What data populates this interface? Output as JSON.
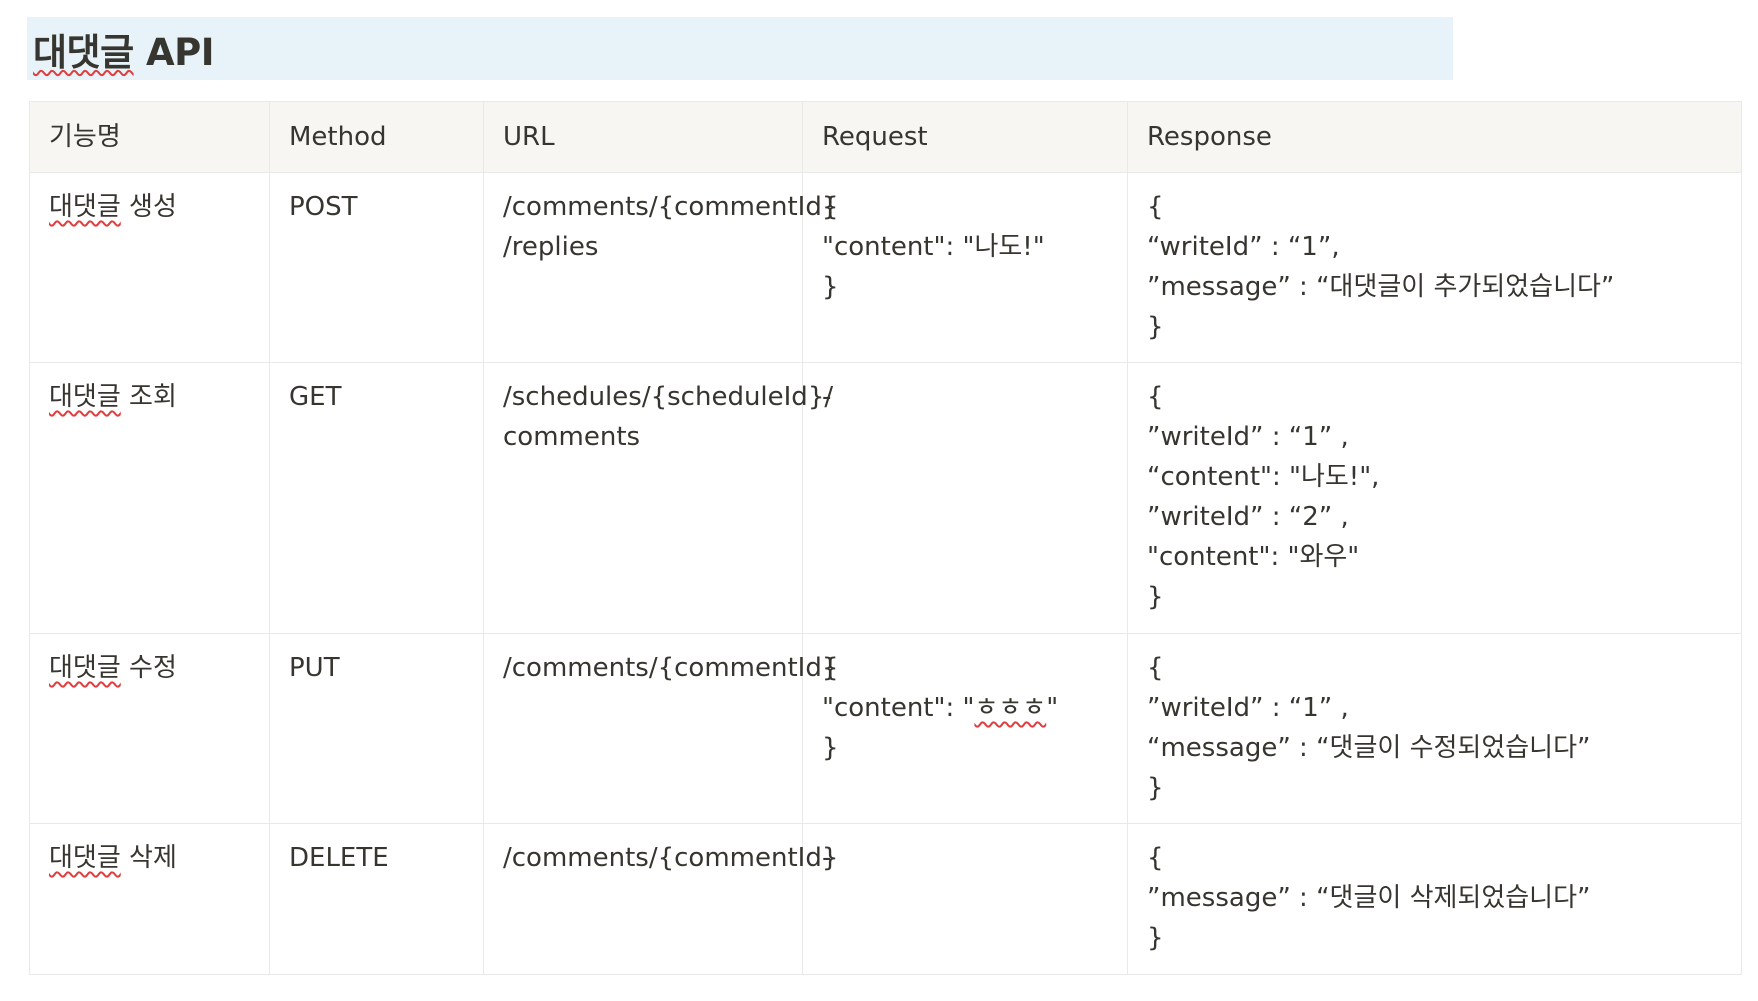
{
  "title": {
    "spellmarked": "대댓글",
    "rest": " API"
  },
  "table": {
    "headers": [
      "기능명",
      "Method",
      "URL",
      "Request",
      "Response"
    ],
    "rows": [
      {
        "feature_marked": "대댓글",
        "feature_rest": " 생성",
        "method": "POST",
        "url": [
          "/comments/{commentId}",
          "/replies"
        ],
        "request": [
          "{",
          "\"content\": \"나도!\"",
          "}"
        ],
        "response": [
          "{",
          "“writeId” : “1”,",
          "”message” : “대댓글이 추가되었습니다”",
          "}"
        ]
      },
      {
        "feature_marked": "대댓글",
        "feature_rest": " 조회",
        "method": "GET",
        "url": [
          "/schedules/{scheduleId}/",
          "comments"
        ],
        "request": [
          "-"
        ],
        "response": [
          "{",
          "”writeId” : “1” ,",
          "“content\": \"나도!\",",
          "”writeId” : “2” ,",
          "\"content\": \"와우\"",
          "}"
        ]
      },
      {
        "feature_marked": "대댓글",
        "feature_rest": " 수정",
        "method": "PUT",
        "url": [
          "/comments/{commentId}"
        ],
        "request_pre": "{",
        "request_mid_before": "\"content\": \"",
        "request_mid_marked": "ㅎㅎㅎ",
        "request_mid_after": "\"",
        "request_post": "}",
        "response": [
          "{",
          "”writeId” : “1” ,",
          "“message” : “댓글이 수정되었습니다”",
          "}"
        ]
      },
      {
        "feature_marked": "대댓글",
        "feature_rest": " 삭제",
        "method": "DELETE",
        "url": [
          "/comments/{commentId}"
        ],
        "request": [
          "-"
        ],
        "response": [
          "{",
          "”message” : “댓글이 삭제되었습니다”",
          "}"
        ]
      }
    ]
  }
}
